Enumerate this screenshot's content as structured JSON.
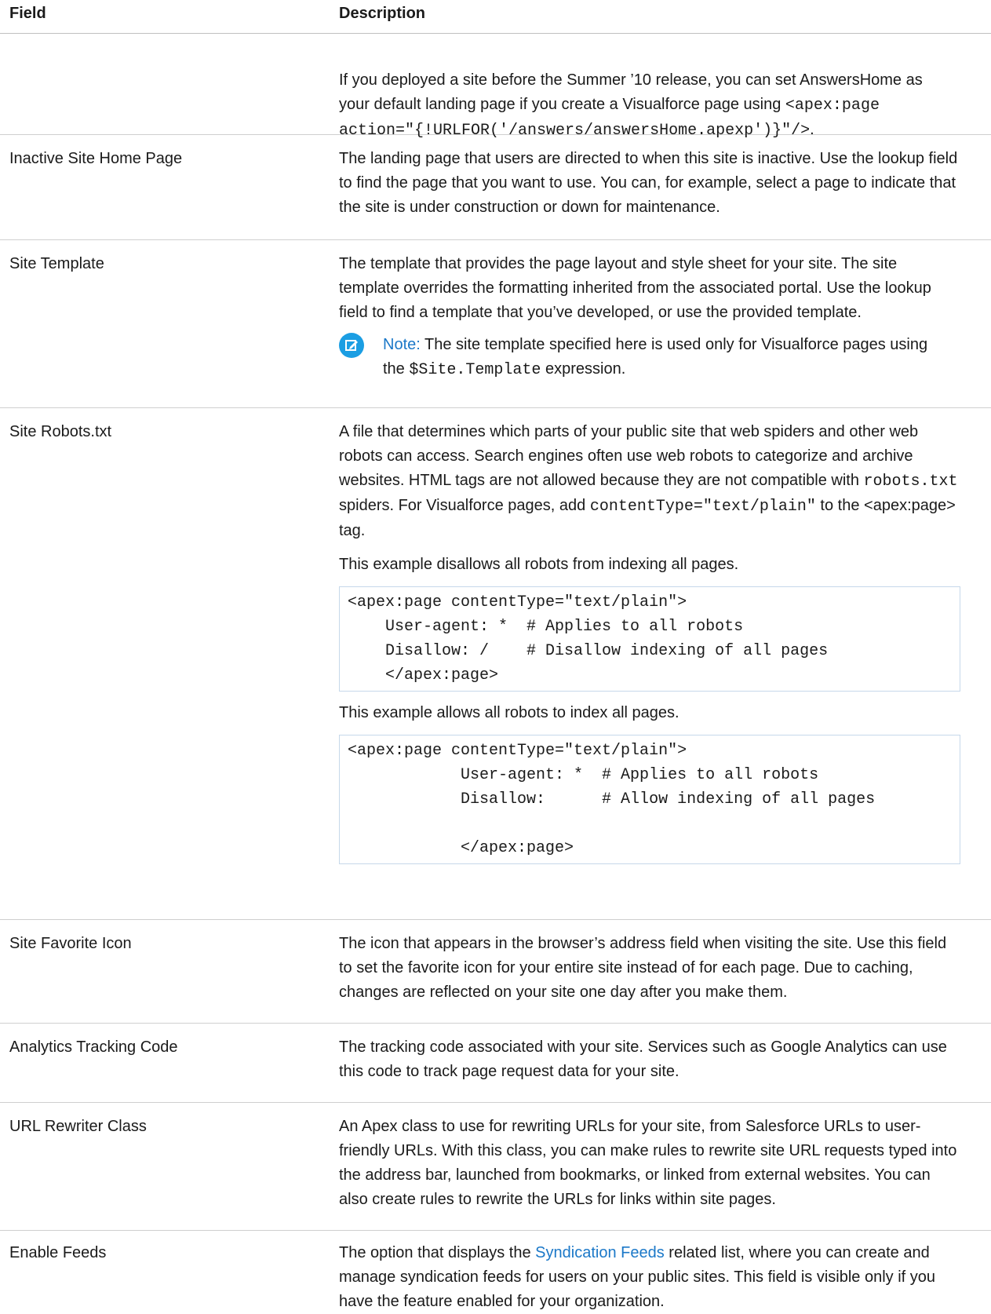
{
  "header": {
    "field": "Field",
    "description": "Description"
  },
  "row0": {
    "line1": "If you deployed a site before the Summer ’10 release, you can set AnswersHome as",
    "line2_pre": "your default landing page if you create a Visualforce page using",
    "line2_code": "<apex:page",
    "line3_code": "action=\"{!URLFOR('/answers/answersHome.apexp')}\"/>",
    "line3_post": "."
  },
  "row1": {
    "field": "Inactive Site Home Page",
    "desc": "The landing page that users are directed to when this site is inactive. Use the lookup field to find the page that you want to use. You can, for example, select a page to indicate that the site is under construction or down for maintenance."
  },
  "row2": {
    "field": "Site Template",
    "desc": "The template that provides the page layout and style sheet for your site. The site template overrides the formatting inherited from the associated portal. Use the lookup field to find a template that you’ve developed, or use the provided template.",
    "note_label": "Note:",
    "note_text1": "The site template specified here is used only for Visualforce pages using",
    "note_text2_pre": "the",
    "note_code": "$Site.Template",
    "note_text2_post": "expression.",
    "note_icon": "edit-note-icon"
  },
  "row3": {
    "field": "Site Robots.txt",
    "desc1": "A file that determines which parts of your public site that web spiders and other web robots can access. Search engines often use web robots to categorize and archive websites. HTML tags are not allowed because they are not compatible with",
    "desc1_code": "robots.txt",
    "desc1_post": "spiders. For Visualforce pages, add",
    "desc1_code2": "contentType=\"text/plain\"",
    "desc1_post2": "to the <apex:page> tag.",
    "example1_intro": "This example disallows all robots from indexing all pages.",
    "example1_code": "<apex:page contentType=\"text/plain\">\n    User-agent: *  # Applies to all robots\n    Disallow: /    # Disallow indexing of all pages\n    </apex:page>",
    "example2_intro": "This example allows all robots to index all pages.",
    "example2_code": "<apex:page contentType=\"text/plain\">\n            User-agent: *  # Applies to all robots\n            Disallow:      # Allow indexing of all pages\n\n            </apex:page>"
  },
  "row4": {
    "field": "Site Favorite Icon",
    "desc": "The icon that appears in the browser’s address field when visiting the site. Use this field to set the favorite icon for your entire site instead of for each page. Due to caching, changes are reflected on your site one day after you make them."
  },
  "row5": {
    "field": "Analytics Tracking Code",
    "desc": "The tracking code associated with your site. Services such as Google Analytics can use this code to track page request data for your site."
  },
  "row6": {
    "field": "URL Rewriter Class",
    "desc": "An Apex class to use for rewriting URLs for your site, from Salesforce URLs to user-friendly URLs. With this class, you can make rules to rewrite site URL requests typed into the address bar, launched from bookmarks, or linked from external websites. You can also create rules to rewrite the URLs for links within site pages."
  },
  "row7": {
    "field": "Enable Feeds",
    "desc_pre": "The option that displays the",
    "desc_link": "Syndication Feeds",
    "desc_post": "related list, where you can create and manage syndication feeds for users on your public sites. This field is visible only if you have the feature enabled for your organization."
  }
}
